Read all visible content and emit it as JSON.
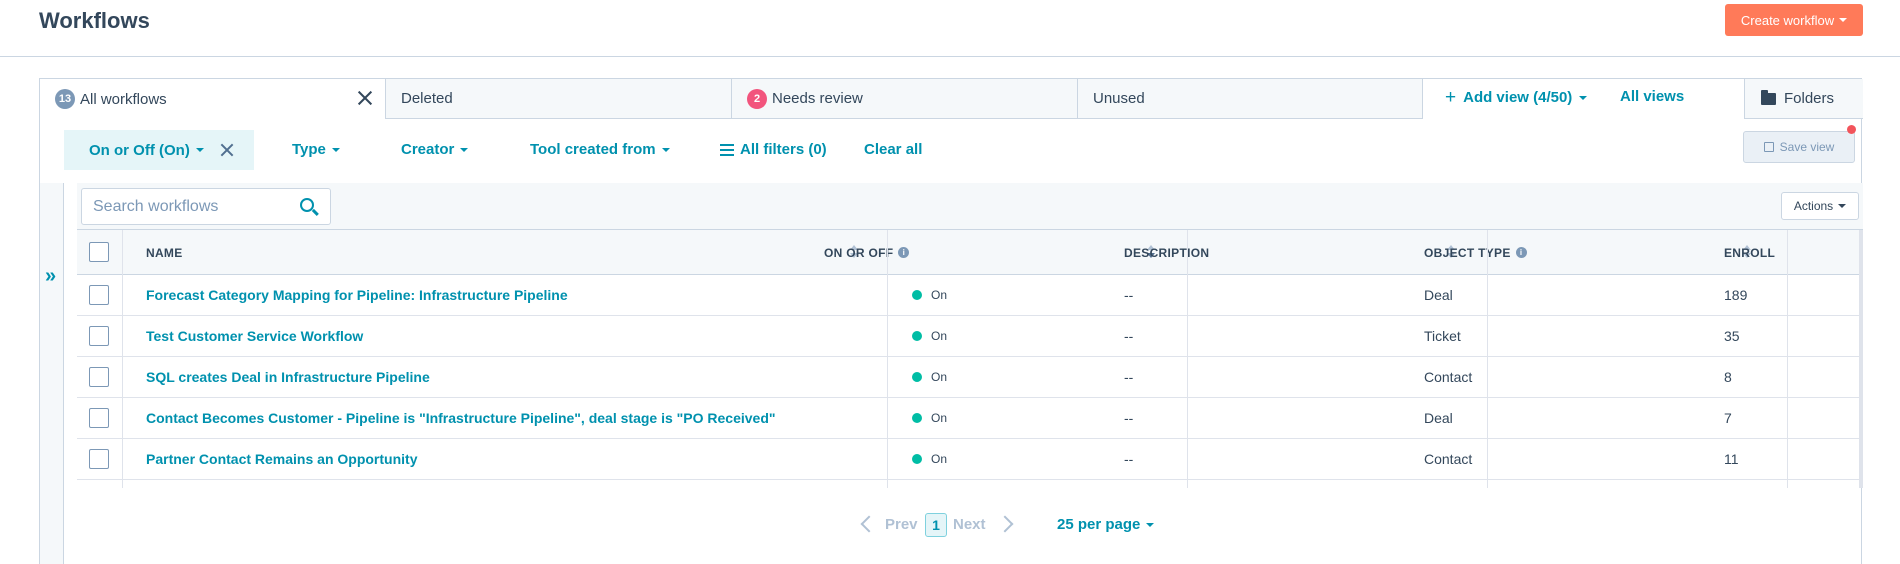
{
  "header": {
    "title": "Workflows",
    "create_label": "Create workflow"
  },
  "tabs": {
    "all": {
      "badge": "13",
      "label": "All workflows"
    },
    "deleted": {
      "label": "Deleted"
    },
    "needs_review": {
      "badge": "2",
      "label": "Needs review"
    },
    "unused": {
      "label": "Unused"
    },
    "add_view": "Add view (4/50)",
    "all_views": "All views",
    "folders": "Folders"
  },
  "filters": {
    "chip": "On or Off (On)",
    "type": "Type",
    "creator": "Creator",
    "tool_created_from": "Tool created from",
    "all_filters": "All filters (0)",
    "clear_all": "Clear all",
    "save_view": "Save view"
  },
  "toolbar": {
    "search_placeholder": "Search workflows",
    "actions": "Actions"
  },
  "table": {
    "columns": [
      "NAME",
      "ON OR OFF",
      "DESCRIPTION",
      "OBJECT TYPE",
      "ENROLL"
    ],
    "rows": [
      {
        "name": "Forecast Category Mapping for Pipeline: Infrastructure Pipeline",
        "status": "On",
        "description": "--",
        "object_type": "Deal",
        "enrolled": "189"
      },
      {
        "name": "Test Customer Service Workflow",
        "status": "On",
        "description": "--",
        "object_type": "Ticket",
        "enrolled": "35"
      },
      {
        "name": "SQL creates Deal in Infrastructure Pipeline",
        "status": "On",
        "description": "--",
        "object_type": "Contact",
        "enrolled": "8"
      },
      {
        "name": "Contact Becomes Customer - Pipeline is \"Infrastructure Pipeline\", deal stage is \"PO Received\"",
        "status": "On",
        "description": "--",
        "object_type": "Deal",
        "enrolled": "7"
      },
      {
        "name": "Partner Contact Remains an Opportunity",
        "status": "On",
        "description": "--",
        "object_type": "Contact",
        "enrolled": "11"
      }
    ]
  },
  "pagination": {
    "prev": "Prev",
    "page": "1",
    "next": "Next",
    "per_page": "25 per page"
  },
  "colors": {
    "accent": "#0091ae",
    "create_button": "#ff7a59",
    "status_on": "#00bda5",
    "badge_review": "#f2547d"
  }
}
